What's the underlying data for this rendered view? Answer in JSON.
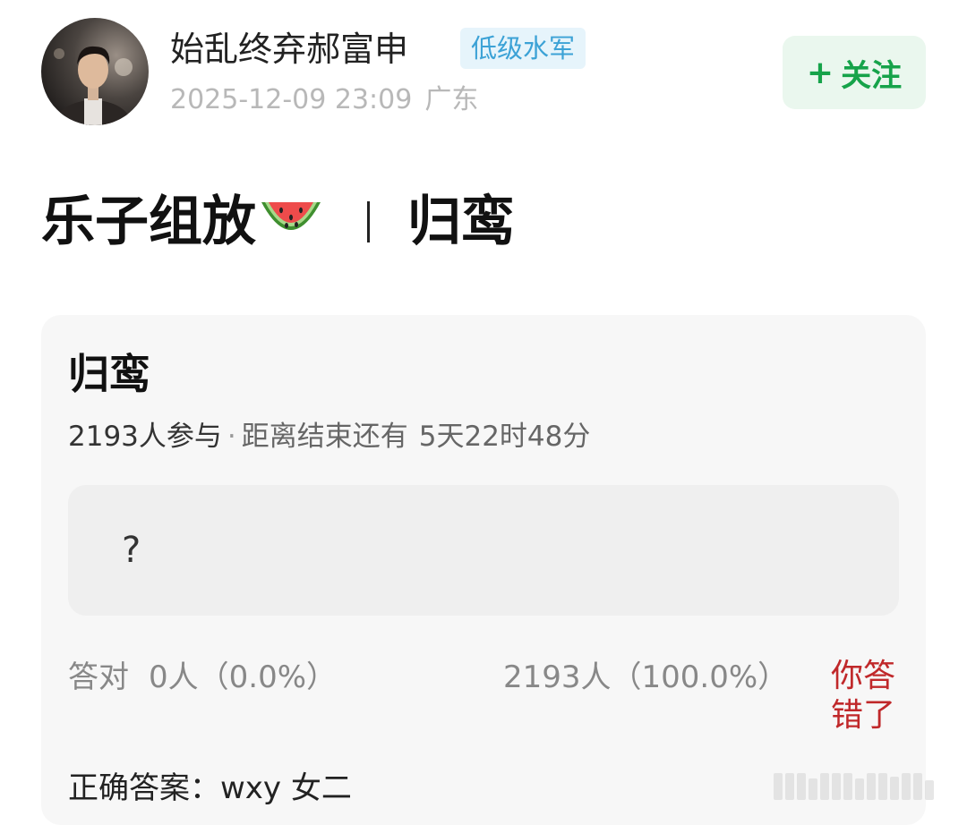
{
  "user": {
    "name": "始乱终弃郝富申",
    "badge": "低级水军",
    "date": "2025-12-09 23:09",
    "location": "广东"
  },
  "follow": {
    "plus": "+",
    "label": "关注"
  },
  "post": {
    "title_left": "乐子组放",
    "title_right": "归鸾",
    "emoji_icon": "watermelon-icon"
  },
  "quiz": {
    "title": "归鸾",
    "participants": "2193人参与",
    "dot": "·",
    "remaining_label": "距离结束还有",
    "remaining_value": "5天22时48分",
    "question": "?",
    "correct_label": "答对",
    "correct_value": "0人（0.0%）",
    "wrong_value": "2193人（100.0%）",
    "wrong_tag_line1": "你答",
    "wrong_tag_line2": "错了",
    "answer": "正确答案：wxy 女二"
  },
  "colors": {
    "follow_green": "#16a34a",
    "badge_blue": "#3ca2d6",
    "wrong_red": "#c0282a"
  }
}
